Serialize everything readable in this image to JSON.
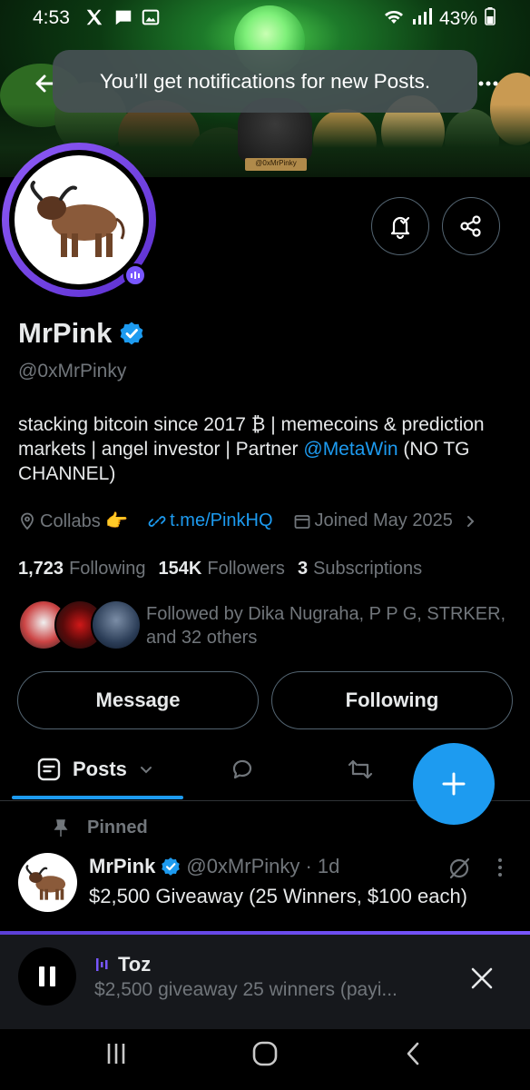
{
  "status_bar": {
    "time": "4:53",
    "battery": "43%",
    "icons": [
      "x-logo-icon",
      "message-icon",
      "image-icon",
      "wifi-icon",
      "signal-icon",
      "battery-icon"
    ]
  },
  "banner": {
    "tag_text": "@0xMrPinky"
  },
  "toast": {
    "text": "You’ll get notifications for new Posts."
  },
  "profile": {
    "name": "MrPink",
    "handle": "@0xMrPinky",
    "bio_text": "stacking bitcoin since 2017 ₿ | memecoins & prediction markets | angel investor | Partner ",
    "bio_link": "@MetaWin",
    "bio_tail": " (NO TG CHANNEL)",
    "location": "Collabs 👉",
    "website": "t.me/PinkHQ",
    "joined": "Joined May 2025",
    "following_count": "1,723",
    "following_label": "Following",
    "followers_count": "154K",
    "followers_label": "Followers",
    "subscriptions_count": "3",
    "subscriptions_label": "Subscriptions",
    "followed_by": "Followed by Dika Nugraha, P P G, STRKER, and 32 others"
  },
  "actions": {
    "message": "Message",
    "following": "Following"
  },
  "tabs": {
    "posts": "Posts"
  },
  "post": {
    "pinned_label": "Pinned",
    "name": "MrPink",
    "handle": "@0xMrPinky · 1d",
    "text": "$2,500 Giveaway (25 Winners, $100 each)"
  },
  "player": {
    "title": "Toz",
    "subtitle": "$2,500 giveaway 25 winners (payi..."
  },
  "colors": {
    "accent": "#1d9bf0",
    "spaces_purple": "#7856ff",
    "background": "#000000"
  }
}
